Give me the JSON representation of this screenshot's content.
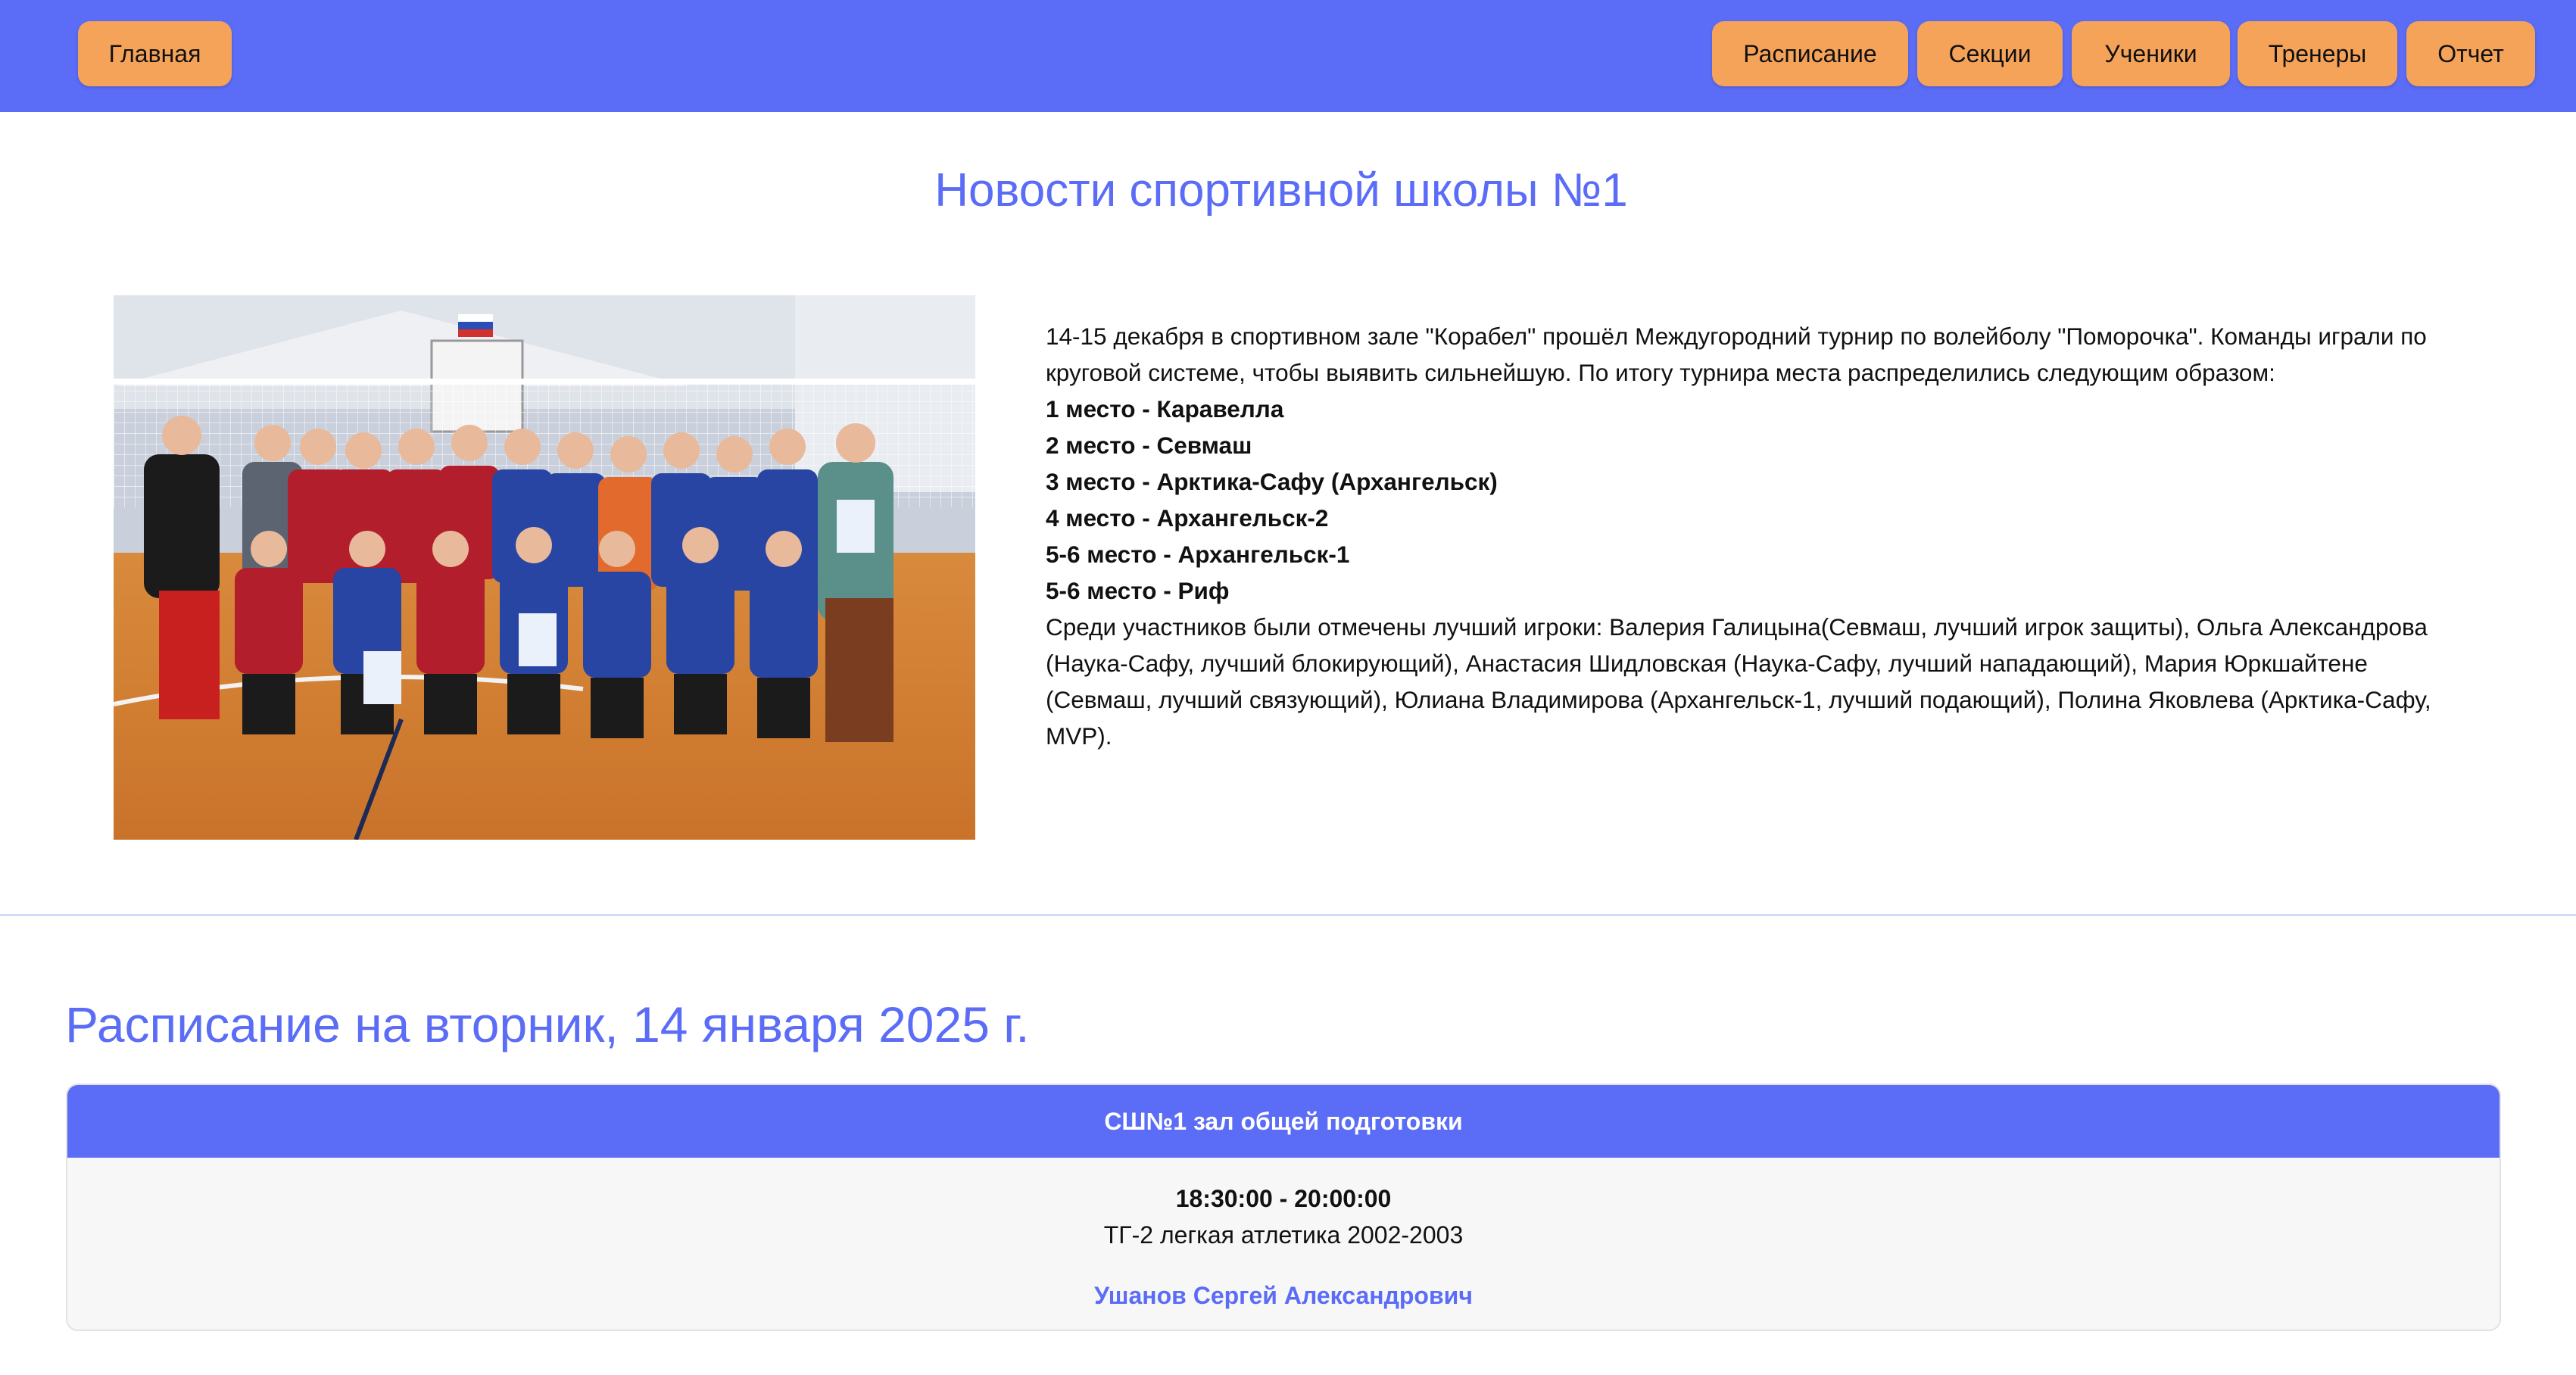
{
  "nav": {
    "home": "Главная",
    "items": [
      "Расписание",
      "Секции",
      "Ученики",
      "Тренеры",
      "Отчет"
    ]
  },
  "news": {
    "title": "Новости спортивной школы №1",
    "intro": "14-15 декабря в спортивном зале \"Корабел\" прошёл Междугородний турнир по волейболу \"Поморочка\". Команды играли по круговой системе, чтобы выявить сильнейшую. По итогу турнира места распределились следующим образом:",
    "places": [
      "1 место - Каравелла",
      "2 место - Севмаш",
      "3 место - Арктика-Сафу (Архангельск)",
      "4 место - Архангельск-2",
      "5-6 место - Архангельск-1",
      "5-6 место - Риф"
    ],
    "outro": "Среди участников были отмечены лучший игроки: Валерия Галицына(Севмаш, лучший игрок защиты), Ольга Александрова (Наука-Сафу, лучший блокирующий), Анастасия Шидловская (Наука-Сафу, лучший нападающий), Мария Юркшайтене (Севмаш, лучший связующий), Юлиана Владимирова (Архангельск-1, лучший подающий), Полина Яковлева (Арктика-Сафу, MVP)."
  },
  "schedule": {
    "title": "Расписание на вторник, 14 января 2025 г.",
    "card": {
      "hall": "СШ№1 зал общей подготовки",
      "time": "18:30:00 - 20:00:00",
      "group": "ТГ-2 легкая атлетика 2002-2003",
      "coach": "Ушанов Сергей Александрович"
    }
  },
  "colors": {
    "accent": "#5b6cf6",
    "button": "#f6a35a",
    "divider": "#d6d9fb"
  }
}
